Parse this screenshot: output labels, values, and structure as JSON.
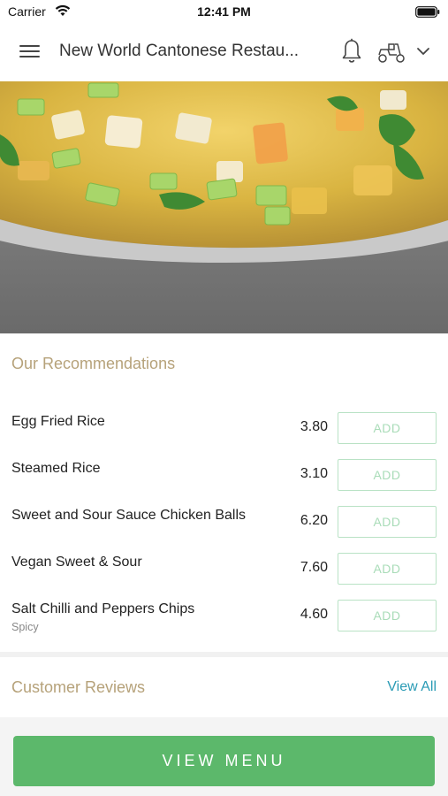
{
  "status_bar": {
    "carrier": "Carrier",
    "time": "12:41 PM"
  },
  "header": {
    "title": "New World Cantonese Restau..."
  },
  "hero": {
    "alt": "soup-photo"
  },
  "recommendations": {
    "title": "Our Recommendations",
    "items": [
      {
        "name": "Egg Fried Rice",
        "tag": "",
        "price": "3.80",
        "add_label": "ADD"
      },
      {
        "name": "Steamed Rice",
        "tag": "",
        "price": "3.10",
        "add_label": "ADD"
      },
      {
        "name": "Sweet and Sour Sauce Chicken Balls",
        "tag": "",
        "price": "6.20",
        "add_label": "ADD"
      },
      {
        "name": "Vegan Sweet & Sour",
        "tag": "",
        "price": "7.60",
        "add_label": "ADD"
      },
      {
        "name": "Salt Chilli and Peppers Chips",
        "tag": "Spicy",
        "price": "4.60",
        "add_label": "ADD"
      }
    ]
  },
  "reviews": {
    "title": "Customer Reviews",
    "view_all_label": "View All"
  },
  "footer": {
    "view_menu_label": "VIEW MENU"
  },
  "colors": {
    "accent_green": "#5cb86b",
    "section_title": "#b6a27a",
    "link_blue": "#2a9bb5",
    "add_border": "#b9e2c5"
  }
}
